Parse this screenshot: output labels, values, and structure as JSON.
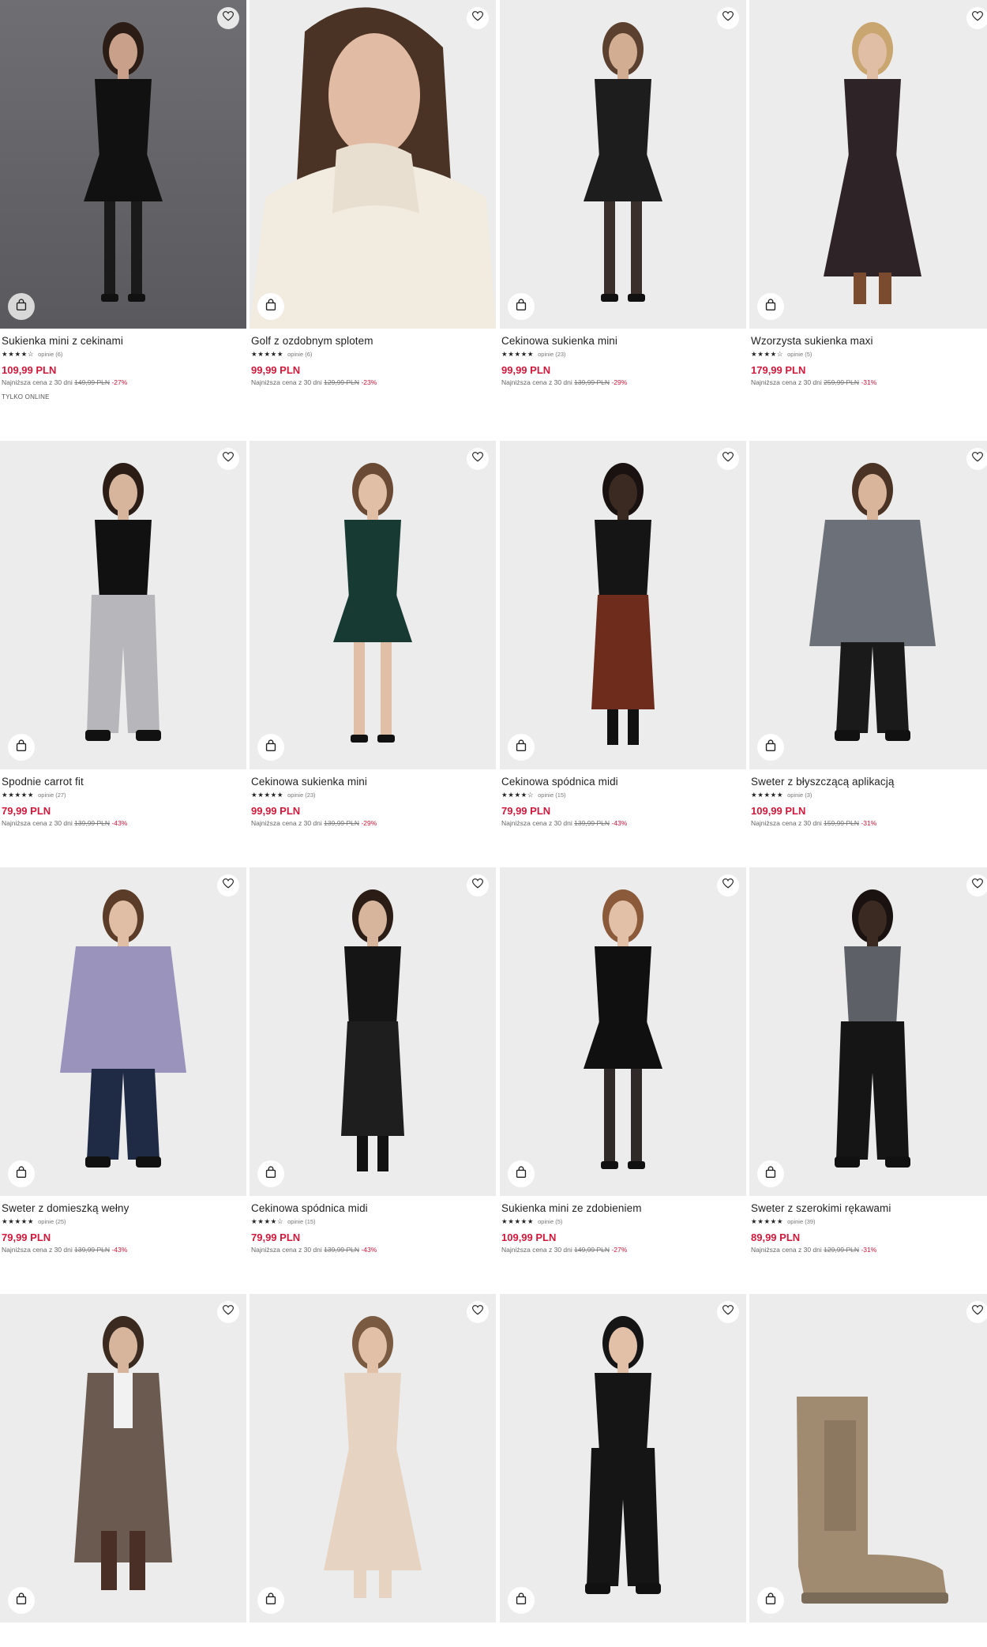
{
  "products": [
    {
      "title": "Sukienka mini z cekinami",
      "stars": "★★★★☆",
      "reviews": "opinie (6)",
      "price": "109,99 PLN",
      "lowest_label": "Najniższa cena z 30 dni",
      "old_price": "149,99 PLN",
      "discount": "-27%",
      "tag": "TYLKO ONLINE",
      "bg": "dark",
      "figure": "black-sequin-slip-dress"
    },
    {
      "title": "Golf z ozdobnym splotem",
      "stars": "★★★★★",
      "reviews": "opinie (6)",
      "price": "99,99 PLN",
      "lowest_label": "Najniższa cena z 30 dni",
      "old_price": "129,99 PLN",
      "discount": "-23%",
      "tag": "",
      "bg": "light",
      "figure": "cream-cable-turtleneck-closeup"
    },
    {
      "title": "Cekinowa sukienka mini",
      "stars": "★★★★★",
      "reviews": "opinie (23)",
      "price": "99,99 PLN",
      "lowest_label": "Najniższa cena z 30 dni",
      "old_price": "139,99 PLN",
      "discount": "-29%",
      "tag": "",
      "bg": "light",
      "figure": "black-sequin-wrap-mini"
    },
    {
      "title": "Wzorzysta sukienka maxi",
      "stars": "★★★★☆",
      "reviews": "opinie (5)",
      "price": "179,99 PLN",
      "lowest_label": "Najniższa cena z 30 dni",
      "old_price": "259,99 PLN",
      "discount": "-31%",
      "tag": "",
      "bg": "light",
      "figure": "dark-maxi-dress-boots"
    },
    {
      "title": "Spodnie carrot fit",
      "stars": "★★★★★",
      "reviews": "opinie (27)",
      "price": "79,99 PLN",
      "lowest_label": "Najniższa cena z 30 dni",
      "old_price": "139,99 PLN",
      "discount": "-43%",
      "tag": "",
      "bg": "light",
      "figure": "grey-carrot-trousers"
    },
    {
      "title": "Cekinowa sukienka mini",
      "stars": "★★★★★",
      "reviews": "opinie (23)",
      "price": "99,99 PLN",
      "lowest_label": "Najniższa cena z 30 dni",
      "old_price": "139,99 PLN",
      "discount": "-29%",
      "tag": "",
      "bg": "light",
      "figure": "green-sequin-mini"
    },
    {
      "title": "Cekinowa spódnica midi",
      "stars": "★★★★☆",
      "reviews": "opinie (15)",
      "price": "79,99 PLN",
      "lowest_label": "Najniższa cena z 30 dni",
      "old_price": "139,99 PLN",
      "discount": "-43%",
      "tag": "",
      "bg": "light",
      "figure": "copper-sequin-midi-skirt"
    },
    {
      "title": "Sweter z błyszczącą aplikacją",
      "stars": "★★★★★",
      "reviews": "opinie (3)",
      "price": "109,99 PLN",
      "lowest_label": "Najniższa cena z 30 dni",
      "old_price": "159,99 PLN",
      "discount": "-31%",
      "tag": "",
      "bg": "light",
      "figure": "grey-embellished-sweater"
    },
    {
      "title": "Sweter z domieszką wełny",
      "stars": "★★★★★",
      "reviews": "opinie (25)",
      "price": "79,99 PLN",
      "lowest_label": "Najniższa cena z 30 dni",
      "old_price": "139,99 PLN",
      "discount": "-43%",
      "tag": "",
      "bg": "light",
      "figure": "lilac-wool-sweater"
    },
    {
      "title": "Cekinowa spódnica midi",
      "stars": "★★★★☆",
      "reviews": "opinie (15)",
      "price": "79,99 PLN",
      "lowest_label": "Najniższa cena z 30 dni",
      "old_price": "139,99 PLN",
      "discount": "-43%",
      "tag": "",
      "bg": "light",
      "figure": "black-sequin-midi-skirt"
    },
    {
      "title": "Sukienka mini ze zdobieniem",
      "stars": "★★★★★",
      "reviews": "opinie (5)",
      "price": "109,99 PLN",
      "lowest_label": "Najniższa cena z 30 dni",
      "old_price": "149,99 PLN",
      "discount": "-27%",
      "tag": "",
      "bg": "light",
      "figure": "black-velvet-skater-dress"
    },
    {
      "title": "Sweter z szerokimi rękawami",
      "stars": "★★★★★",
      "reviews": "opinie (39)",
      "price": "89,99 PLN",
      "lowest_label": "Najniższa cena z 30 dni",
      "old_price": "129,99 PLN",
      "discount": "-31%",
      "tag": "",
      "bg": "light",
      "figure": "grey-wide-sleeve-sweater"
    },
    {
      "title": "",
      "stars": "",
      "reviews": "",
      "price": "",
      "lowest_label": "",
      "old_price": "",
      "discount": "",
      "tag": "",
      "bg": "light",
      "figure": "brown-long-coat"
    },
    {
      "title": "",
      "stars": "",
      "reviews": "",
      "price": "",
      "lowest_label": "",
      "old_price": "",
      "discount": "",
      "tag": "",
      "bg": "light",
      "figure": "beige-rib-knit-dress"
    },
    {
      "title": "",
      "stars": "",
      "reviews": "",
      "price": "",
      "lowest_label": "",
      "old_price": "",
      "discount": "",
      "tag": "",
      "bg": "light",
      "figure": "black-tailored-trousers"
    },
    {
      "title": "",
      "stars": "",
      "reviews": "",
      "price": "",
      "lowest_label": "",
      "old_price": "",
      "discount": "",
      "tag": "",
      "bg": "light",
      "figure": "beige-chelsea-boot"
    }
  ],
  "icons": {
    "favorite": "heart-icon",
    "add_to_cart": "shopping-bag-icon"
  },
  "colors": {
    "price": "#d0193b",
    "text": "#222222",
    "background": "#ffffff"
  }
}
